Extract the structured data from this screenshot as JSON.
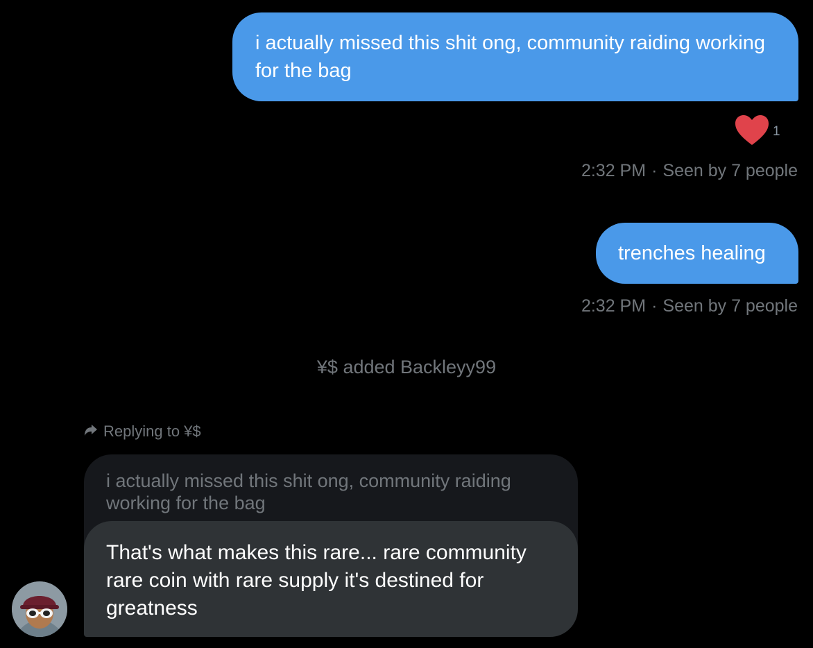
{
  "messages": {
    "sent1": {
      "text": "i actually missed this shit ong, community raiding working for the bag",
      "reaction_count": "1",
      "time": "2:32 PM",
      "seen": "Seen by 7 people"
    },
    "sent2": {
      "text": "trenches healing",
      "time": "2:32 PM",
      "seen": "Seen by 7 people"
    },
    "system_event": "¥$ added Backleyy99",
    "reply": {
      "indicator": "Replying to ¥$",
      "quoted_text": "i actually missed this shit ong, community raiding working for the bag",
      "text": "That's what makes this rare... rare community rare coin with rare supply it's destined for greatness"
    }
  },
  "meta_separator": "·",
  "colors": {
    "background": "#000000",
    "sent_bubble": "#4a99e9",
    "received_bubble": "#2f3336",
    "quoted_bubble": "#16181c",
    "muted_text": "#71767b",
    "heart": "#e0434b"
  },
  "icons": {
    "reaction": "heart-icon",
    "reply": "reply-arrow-icon"
  }
}
